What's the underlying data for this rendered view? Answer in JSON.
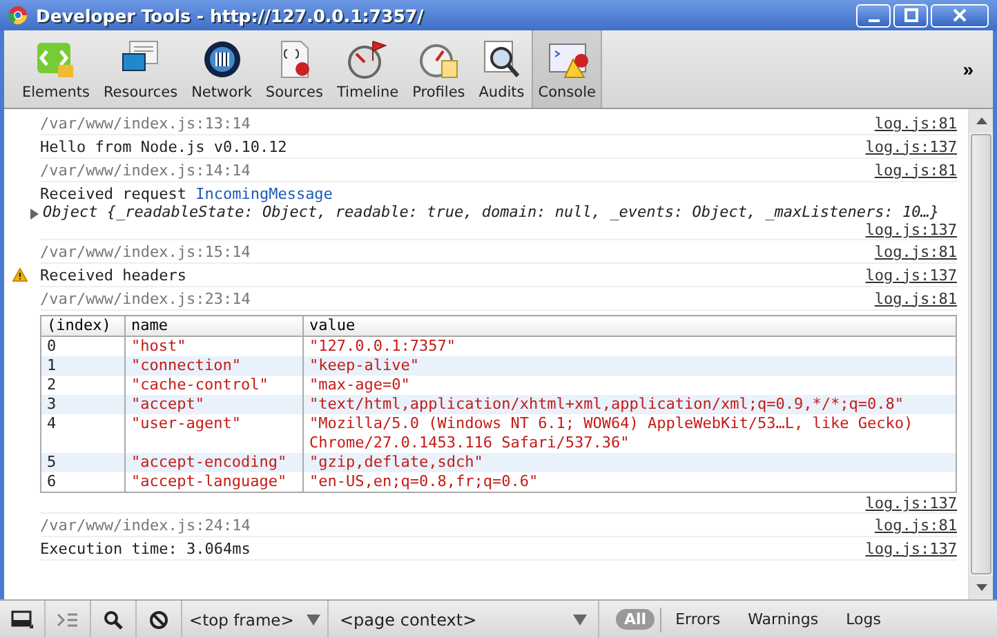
{
  "window": {
    "title": "Developer Tools - http://127.0.0.1:7357/"
  },
  "toolbar": {
    "tabs": [
      {
        "label": "Elements",
        "selected": false
      },
      {
        "label": "Resources",
        "selected": false
      },
      {
        "label": "Network",
        "selected": false
      },
      {
        "label": "Sources",
        "selected": false
      },
      {
        "label": "Timeline",
        "selected": false
      },
      {
        "label": "Profiles",
        "selected": false
      },
      {
        "label": "Audits",
        "selected": false
      },
      {
        "label": "Console",
        "selected": true
      }
    ],
    "overflow": "»"
  },
  "console": {
    "entries": [
      {
        "kind": "source",
        "text": "/var/www/index.js:13:14",
        "link": "log.js:81"
      },
      {
        "kind": "log",
        "warning": false,
        "text": "Hello from Node.js v0.10.12",
        "link": "log.js:137"
      },
      {
        "kind": "source",
        "text": "/var/www/index.js:14:14",
        "link": "log.js:81"
      },
      {
        "kind": "object",
        "text": "Received request",
        "type_name": "IncomingMessage",
        "object": {
          "preview": "Object {_readableState: Object, readable: true, domain: null, _events: Object, _maxListeners: 10…}",
          "expanded": false
        },
        "link": "log.js:137"
      },
      {
        "kind": "source",
        "text": "/var/www/index.js:15:14",
        "link": "log.js:81"
      },
      {
        "kind": "log",
        "warning": true,
        "text": "Received headers",
        "link": "log.js:137"
      },
      {
        "kind": "source",
        "text": "/var/www/index.js:23:14",
        "link": "log.js:81"
      },
      {
        "kind": "table",
        "columns": [
          "(index)",
          "name",
          "value"
        ],
        "rows": [
          [
            "0",
            "\"host\"",
            "\"127.0.0.1:7357\""
          ],
          [
            "1",
            "\"connection\"",
            "\"keep-alive\""
          ],
          [
            "2",
            "\"cache-control\"",
            "\"max-age=0\""
          ],
          [
            "3",
            "\"accept\"",
            "\"text/html,application/xhtml+xml,application/xml;q=0.9,*/*;q=0.8\""
          ],
          [
            "4",
            "\"user-agent\"",
            "\"Mozilla/5.0 (Windows NT 6.1; WOW64) AppleWebKit/53…L, like Gecko) Chrome/27.0.1453.116 Safari/537.36\""
          ],
          [
            "5",
            "\"accept-encoding\"",
            "\"gzip,deflate,sdch\""
          ],
          [
            "6",
            "\"accept-language\"",
            "\"en-US,en;q=0.8,fr;q=0.6\""
          ]
        ],
        "link": "log.js:137"
      },
      {
        "kind": "source",
        "text": "/var/www/index.js:24:14",
        "link": "log.js:81"
      },
      {
        "kind": "log",
        "warning": false,
        "text": "Execution time: 3.064ms",
        "link": "log.js:137"
      }
    ]
  },
  "status_bar": {
    "frame": "<top frame>",
    "context": "<page context>",
    "filters": [
      {
        "label": "All",
        "selected": true
      },
      {
        "label": "Errors",
        "selected": false
      },
      {
        "label": "Warnings",
        "selected": false
      },
      {
        "label": "Logs",
        "selected": false
      }
    ]
  }
}
